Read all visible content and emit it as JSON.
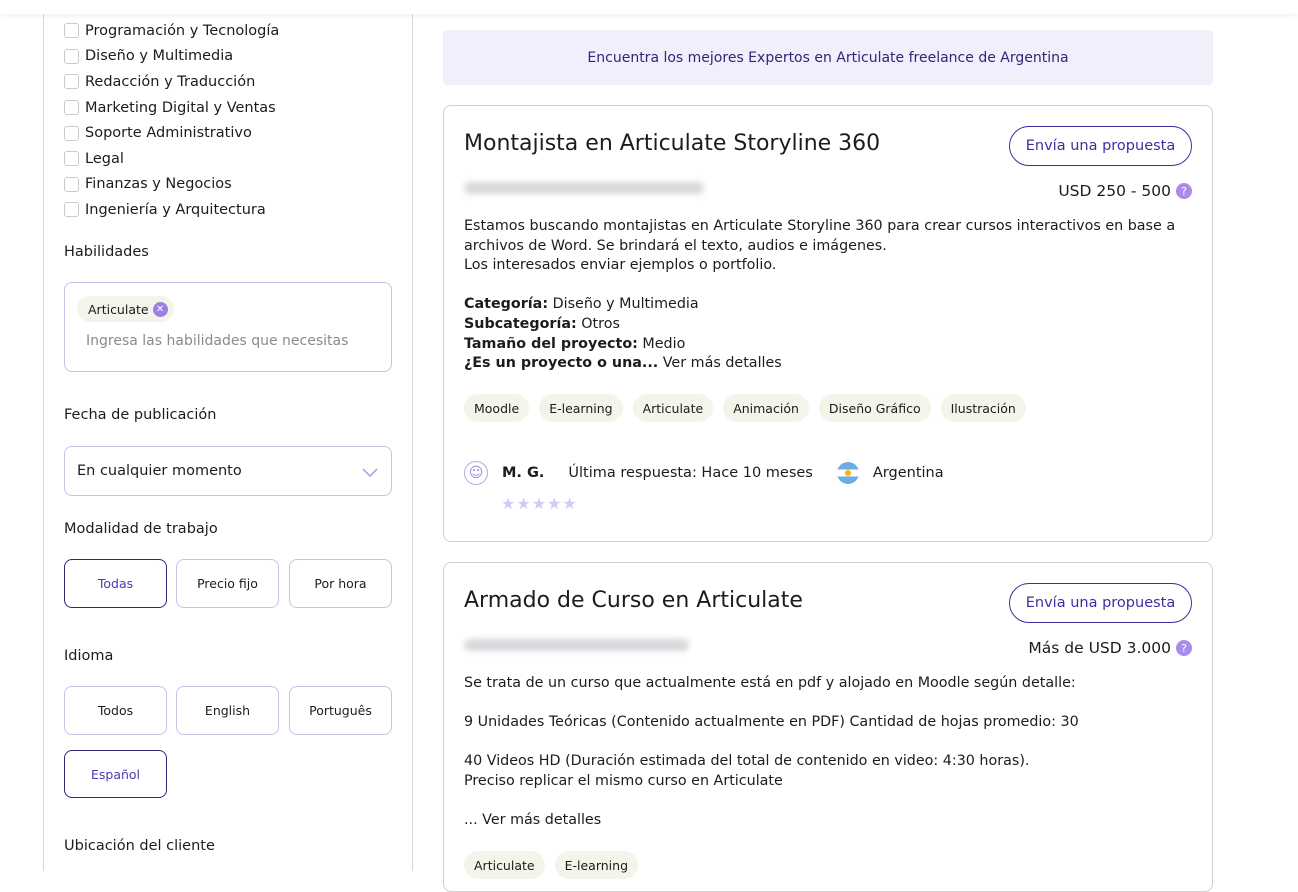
{
  "sidebar": {
    "categories": [
      "Programación y Tecnología",
      "Diseño y Multimedia",
      "Redacción y Traducción",
      "Marketing Digital y Ventas",
      "Soporte Administrativo",
      "Legal",
      "Finanzas y Negocios",
      "Ingeniería y Arquitectura"
    ],
    "skills_label": "Habilidades",
    "skill_chip": "Articulate",
    "skills_placeholder": "Ingresa las habilidades que necesitas",
    "date_label": "Fecha de publicación",
    "date_value": "En cualquier momento",
    "mode_label": "Modalidad de trabajo",
    "modes": [
      "Todas",
      "Precio fijo",
      "Por hora"
    ],
    "active_mode": "Todas",
    "language_label": "Idioma",
    "languages": [
      "Todos",
      "English",
      "Português",
      "Español"
    ],
    "active_language": "Español",
    "location_label": "Ubicación del cliente"
  },
  "banner": "Encuentra los mejores Expertos en Articulate freelance de Argentina",
  "propose_label": "Envía una propuesta",
  "projects": [
    {
      "title": "Montajista en Articulate Storyline 360",
      "price": "USD 250 - 500",
      "desc": [
        "Estamos buscando montajistas en Articulate Storyline 360 para crear cursos interactivos en base a",
        "archivos de Word. Se brindará el texto, audios e imágenes.",
        "Los interesados enviar ejemplos o portfolio.",
        ""
      ],
      "fields": [
        {
          "k": "Categoría:",
          "v": " Diseño y Multimedia"
        },
        {
          "k": "Subcategoría:",
          "v": " Otros"
        },
        {
          "k": "Tamaño del proyecto:",
          "v": " Medio"
        }
      ],
      "last_line_bold": "¿Es un proyecto o una...",
      "more": " Ver más detalles",
      "tags": [
        "Moodle",
        "E-learning",
        "Articulate",
        "Animación",
        "Diseño Gráfico",
        "Ilustración"
      ],
      "client": "M. G.",
      "last_reply": "Última respuesta: Hace 10 meses",
      "country": "Argentina"
    },
    {
      "title": "Armado de Curso en Articulate",
      "price": "Más de USD 3.000",
      "desc": [
        "Se trata de un curso que actualmente está en pdf y alojado en Moodle según detalle:",
        "",
        "9 Unidades Teóricas (Contenido actualmente en PDF) Cantidad de hojas promedio: 30",
        "",
        "40 Videos HD (Duración estimada del total de contenido en video: 4:30 horas).",
        "Preciso replicar el mismo curso en Articulate",
        ""
      ],
      "more": "... Ver más detalles",
      "tags": [
        "Articulate",
        "E-learning"
      ]
    }
  ],
  "icons": {
    "chip_remove": "close-icon",
    "select": "chevron-down-icon",
    "price_help": "help-icon",
    "avatar": "smiley-avatar-icon",
    "rating": "star-icon",
    "flag": "argentina-flag-icon"
  },
  "colors": {
    "accent": "#3d2fa0",
    "banner_bg": "#f2effd",
    "tag_bg": "#f4f4ea",
    "help": "#a98ce8"
  }
}
